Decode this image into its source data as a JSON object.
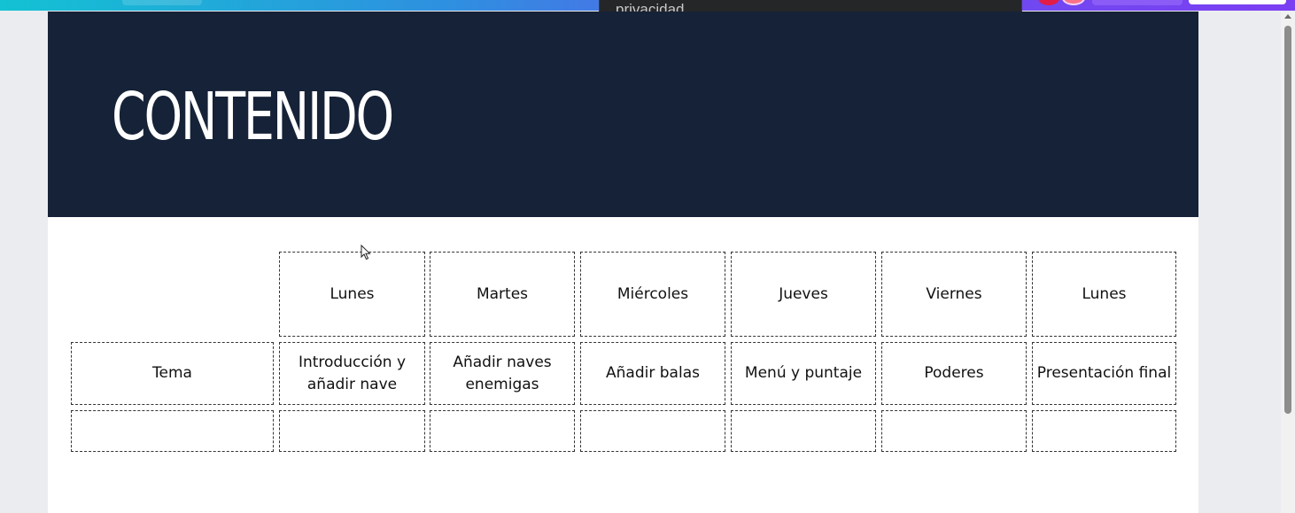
{
  "tooltip": {
    "text": "privacidad"
  },
  "slide": {
    "title": "CONTENIDO"
  },
  "table": {
    "headers": [
      "",
      "Lunes",
      "Martes",
      "Miércoles",
      "Jueves",
      "Viernes",
      "Lunes"
    ],
    "rows": [
      [
        "Tema",
        "Introducción y añadir nave",
        "Añadir naves enemigas",
        "Añadir balas",
        "Menú y puntaje",
        "Poderes",
        "Presentación final"
      ],
      [
        "",
        "",
        "",
        "",
        "",
        "",
        ""
      ]
    ]
  },
  "colors": {
    "header_bg": "#162237",
    "accent_gradient_start": "#13c2d3",
    "accent_gradient_end": "#7b3ff2"
  }
}
